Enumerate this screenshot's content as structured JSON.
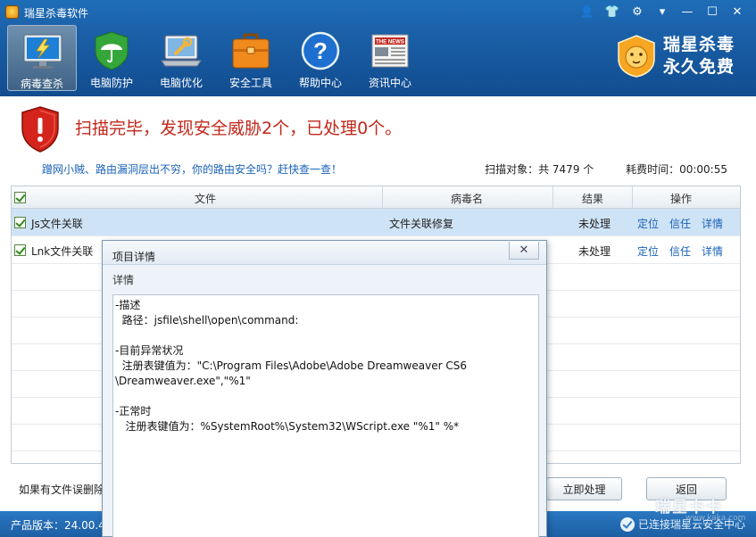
{
  "app": {
    "title": "瑞星杀毒软件"
  },
  "window_controls": [
    {
      "name": "user-icon",
      "glyph": "👤"
    },
    {
      "name": "skin-icon",
      "glyph": "👕"
    },
    {
      "name": "settings-icon",
      "glyph": "⚙"
    },
    {
      "name": "menu-icon",
      "glyph": "▾"
    },
    {
      "name": "minimize-icon",
      "glyph": "—"
    },
    {
      "name": "maximize-icon",
      "glyph": "☐"
    },
    {
      "name": "close-icon",
      "glyph": "✕"
    }
  ],
  "nav": {
    "items": [
      {
        "label": "病毒查杀",
        "icon": "monitor-lightning-icon",
        "active": true
      },
      {
        "label": "电脑防护",
        "icon": "umbrella-shield-icon",
        "active": false
      },
      {
        "label": "电脑优化",
        "icon": "laptop-wrench-icon",
        "active": false
      },
      {
        "label": "安全工具",
        "icon": "toolbox-icon",
        "active": false
      },
      {
        "label": "帮助中心",
        "icon": "help-icon",
        "active": false
      },
      {
        "label": "资讯中心",
        "icon": "newspaper-icon",
        "active": false
      }
    ]
  },
  "promo": {
    "line1": "瑞星杀毒",
    "line2": "永久免费",
    "newspaper_text": "THE NEWS"
  },
  "scan": {
    "title": "扫描完毕，发现安全威胁2个，已处理0个。",
    "tip": "蹭网小贼、路由漏洞层出不穷，你的路由安全吗？赶快查一查！",
    "objects": "扫描对象：共 7479 个",
    "elapsed": "耗费时间：00:00:55"
  },
  "table": {
    "headers": {
      "file": "文件",
      "virus": "病毒名",
      "result": "结果",
      "action": "操作"
    },
    "rows": [
      {
        "file": "Js文件关联",
        "virus": "文件关联修复",
        "result": "未处理",
        "locate": "定位",
        "trust": "信任",
        "detail": "详情"
      },
      {
        "file": "Lnk文件关联",
        "virus": "",
        "result": "未处理",
        "locate": "定位",
        "trust": "信任",
        "detail": "详情"
      }
    ]
  },
  "footer": {
    "note": "如果有文件误删除",
    "process_btn": "立即处理",
    "back_btn": "返回"
  },
  "statusbar": {
    "version": "产品版本：24.00.4",
    "cloud": "已连接瑞星云安全中心"
  },
  "watermark": {
    "main": "瑞星卡卡",
    "sub": "www.kaka.com"
  },
  "dialog": {
    "title": "项目详情",
    "close_glyph": "✕",
    "subtitle": "详情",
    "lines": [
      "-描述",
      "  路径：jsfile\\shell\\open\\command:",
      "",
      "-目前异常状况",
      "  注册表键值为：\"C:\\Program Files\\Adobe\\Adobe Dreamweaver CS6",
      "\\Dreamweaver.exe\",\"%1\"",
      "",
      "-正常时",
      "   注册表键值为：%SystemRoot%\\System32\\WScript.exe \"%1\" %*"
    ]
  },
  "colors": {
    "accent": "#1a60a8",
    "danger": "#c1271a",
    "link": "#1a62b8",
    "selected_row": "#cfe3f6"
  }
}
